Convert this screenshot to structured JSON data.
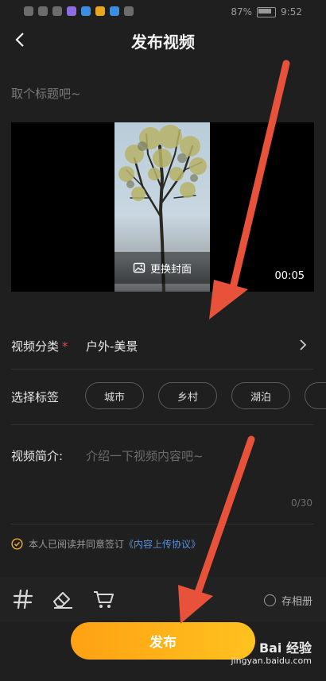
{
  "status_bar": {
    "battery": "87%",
    "time": "9:52"
  },
  "header": {
    "title": "发布视频"
  },
  "title_input": {
    "placeholder": "取个标题吧~"
  },
  "video": {
    "cover_label": "更换封面",
    "duration": "00:05"
  },
  "category": {
    "label": "视频分类",
    "required_mark": "*",
    "value": "户外-美景"
  },
  "tags": {
    "label": "选择标签",
    "items": [
      "城市",
      "乡村",
      "湖泊"
    ]
  },
  "description": {
    "label": "视频简介:",
    "placeholder": "介绍一下视频内容吧~",
    "count": "0/30"
  },
  "agreement": {
    "text": "本人已阅读并同意签订",
    "link": "《内容上传协议》"
  },
  "toolbar": {
    "album_label": "存相册"
  },
  "publish_button": {
    "label": "发布"
  },
  "watermark": {
    "brand": "Bai 经验",
    "url": "jingyan.baidu.com"
  },
  "colors": {
    "accent": "#ffb31a",
    "link": "#5a8fd6",
    "annotation_arrow": "#e8523a"
  }
}
